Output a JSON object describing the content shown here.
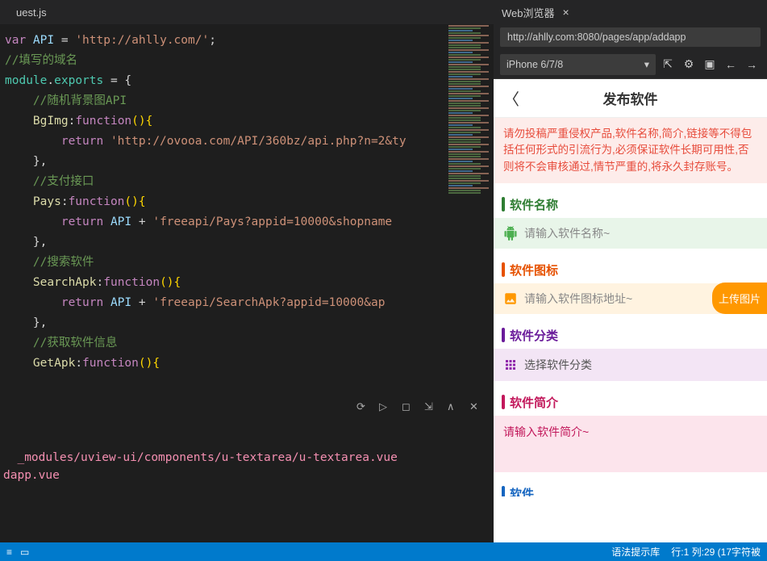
{
  "editor": {
    "tab": "uest.js",
    "lines": {
      "l1_var": "var",
      "l1_api": " API ",
      "l1_eq": "= ",
      "l1_str": "'http://ahlly.com/'",
      "l1_semi": ";",
      "l2": "//填写的域名",
      "l3_mod": "module",
      "l3_dot": ".",
      "l3_exp": "exports",
      "l3_rest": " = {",
      "l4": "    //随机背景图API",
      "l5_name": "    BgImg",
      "l5_colon": ":",
      "l5_fn": "function",
      "l5_paren": "(){",
      "l6_ret": "        return",
      "l6_str": " 'http://ovooa.com/API/360bz/api.php?n=2&ty",
      "l7": "    },",
      "l8": "    //支付接口",
      "l9_name": "    Pays",
      "l10_ret": "        return",
      "l10_api": " API ",
      "l10_plus": "+ ",
      "l10_str": "'freeapi/Pays?appid=10000&shopname",
      "l12": "    //搜索软件",
      "l13_name": "    SearchApk",
      "l14_str": "'freeapi/SearchApk?appid=10000&ap",
      "l16": "    //获取软件信息",
      "l17_name": "    GetApk"
    }
  },
  "terminal": {
    "line1": "  _modules/uview-ui/components/u-textarea/u-textarea.vue",
    "line2": "dapp.vue"
  },
  "status": {
    "hint": "语法提示库",
    "pos": "行:1 列:29 (17字符被"
  },
  "browser": {
    "title": "Web浏览器",
    "url": "http://ahlly.com:8080/pages/app/addapp",
    "device": "iPhone 6/7/8"
  },
  "phone": {
    "title": "发布软件",
    "notice": "请勿投稿严重侵权产品,软件名称,简介,链接等不得包括任何形式的引流行为,必须保证软件长期可用性,否则将不会审核通过,情节严重的,将永久封存账号。",
    "sec_name": "软件名称",
    "ph_name": "请输入软件名称~",
    "sec_icon": "软件图标",
    "ph_icon": "请输入软件图标地址~",
    "upload": "上传图片",
    "sec_cat": "软件分类",
    "ph_cat": "选择软件分类",
    "sec_intro": "软件简介",
    "ph_intro": "请输入软件简介~",
    "sec_next": "软件"
  }
}
